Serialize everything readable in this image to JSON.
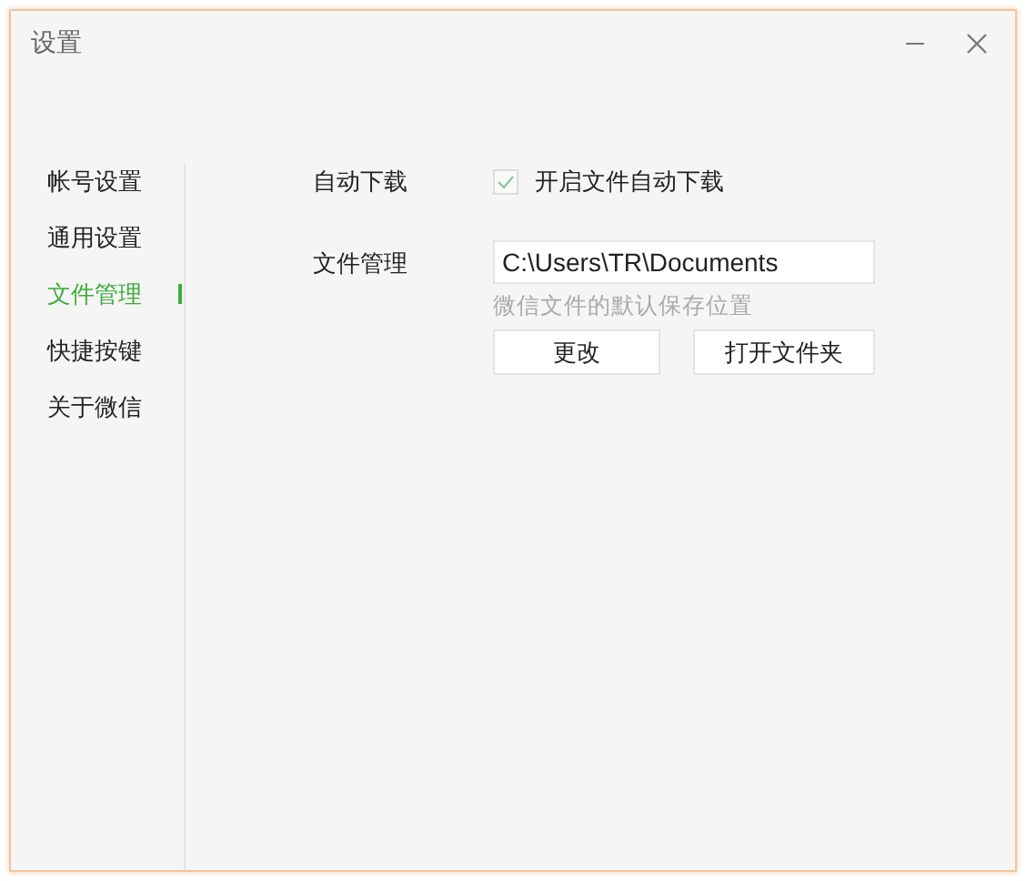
{
  "window": {
    "title": "设置"
  },
  "sidebar": {
    "items": [
      {
        "label": "帐号设置",
        "selected": false
      },
      {
        "label": "通用设置",
        "selected": false
      },
      {
        "label": "文件管理",
        "selected": true
      },
      {
        "label": "快捷按键",
        "selected": false
      },
      {
        "label": "关于微信",
        "selected": false
      }
    ]
  },
  "auto_download": {
    "label": "自动下载",
    "checkbox": {
      "label": "开启文件自动下载",
      "checked": true
    }
  },
  "file_management": {
    "label": "文件管理",
    "path": "C:\\Users\\TR\\Documents",
    "hint": "微信文件的默认保存位置",
    "buttons": [
      "更改",
      "打开文件夹"
    ]
  }
}
